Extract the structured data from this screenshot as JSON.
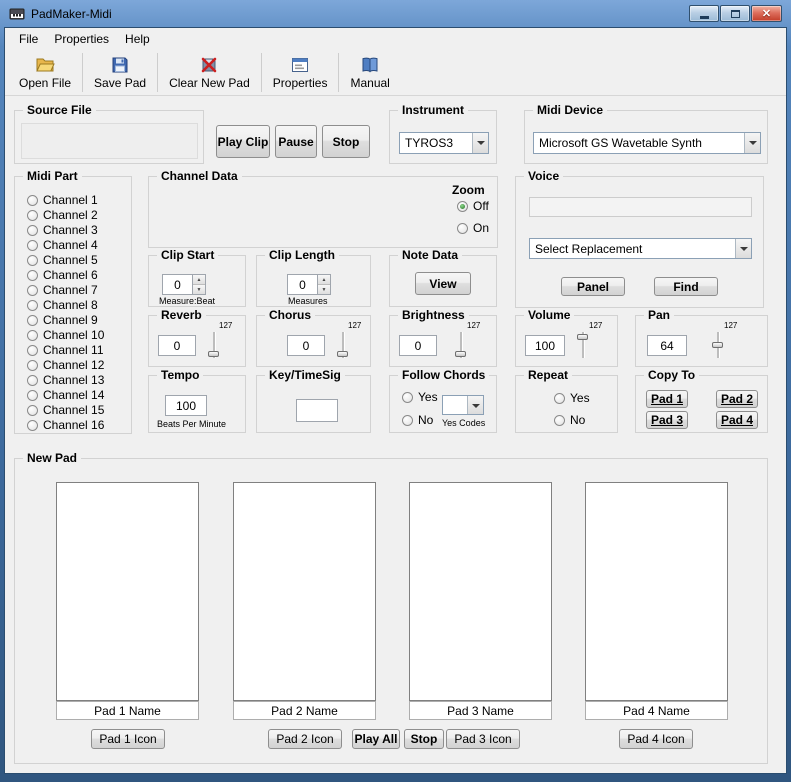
{
  "window": {
    "title": "PadMaker-Midi"
  },
  "icons": {
    "close": "✕",
    "spin_up": "▲",
    "spin_down": "▼"
  },
  "menu": {
    "file": "File",
    "properties": "Properties",
    "help": "Help"
  },
  "toolbar": {
    "open_file": "Open File",
    "save_pad": "Save Pad",
    "clear_new_pad": "Clear New Pad",
    "properties": "Properties",
    "manual": "Manual"
  },
  "source_file": {
    "label": "Source File"
  },
  "transport": {
    "play_clip": "Play Clip",
    "pause": "Pause",
    "stop": "Stop"
  },
  "instrument": {
    "label": "Instrument",
    "value": "TYROS3"
  },
  "midi_device": {
    "label": "Midi Device",
    "value": "Microsoft GS Wavetable Synth"
  },
  "midi_part": {
    "label": "Midi Part",
    "channels": [
      "Channel 1",
      "Channel 2",
      "Channel 3",
      "Channel 4",
      "Channel 5",
      "Channel 6",
      "Channel 7",
      "Channel 8",
      "Channel 9",
      "Channel 10",
      "Channel 11",
      "Channel 12",
      "Channel 13",
      "Channel 14",
      "Channel 15",
      "Channel 16"
    ]
  },
  "channel_data": {
    "label": "Channel Data",
    "zoom": {
      "label": "Zoom",
      "off": "Off",
      "on": "On",
      "selected": "Off"
    }
  },
  "voice": {
    "label": "Voice",
    "current_value": "",
    "replacement": "Select Replacement",
    "panel": "Panel",
    "find": "Find"
  },
  "clip_start": {
    "label": "Clip Start",
    "value": "0",
    "unit": "Measure:Beat"
  },
  "clip_length": {
    "label": "Clip Length",
    "value": "0",
    "unit": "Measures"
  },
  "note_data": {
    "label": "Note Data",
    "view": "View"
  },
  "reverb": {
    "label": "Reverb",
    "value": "0",
    "max": "127"
  },
  "chorus": {
    "label": "Chorus",
    "value": "0",
    "max": "127"
  },
  "brightness": {
    "label": "Brightness",
    "value": "0",
    "max": "127"
  },
  "volume": {
    "label": "Volume",
    "value": "100",
    "max": "127"
  },
  "pan": {
    "label": "Pan",
    "value": "64",
    "max": "127"
  },
  "tempo": {
    "label": "Tempo",
    "value": "100",
    "unit": "Beats Per Minute"
  },
  "key_timesig": {
    "label": "Key/TimeSig",
    "value": ""
  },
  "follow_chords": {
    "label": "Follow Chords",
    "yes": "Yes",
    "no": "No",
    "codes_label": "Yes Codes"
  },
  "repeat": {
    "label": "Repeat",
    "yes": "Yes",
    "no": "No"
  },
  "copy_to": {
    "label": "Copy To",
    "pads": [
      "Pad 1",
      "Pad 2",
      "Pad 3",
      "Pad 4"
    ]
  },
  "new_pad": {
    "label": "New Pad",
    "pads": [
      {
        "name": "Pad 1 Name",
        "icon_button": "Pad 1 Icon"
      },
      {
        "name": "Pad 2 Name",
        "icon_button": "Pad 2 Icon"
      },
      {
        "name": "Pad 3 Name",
        "icon_button": "Pad 3 Icon"
      },
      {
        "name": "Pad 4 Name",
        "icon_button": "Pad 4 Icon"
      }
    ],
    "play_all": "Play All",
    "stop": "Stop"
  }
}
